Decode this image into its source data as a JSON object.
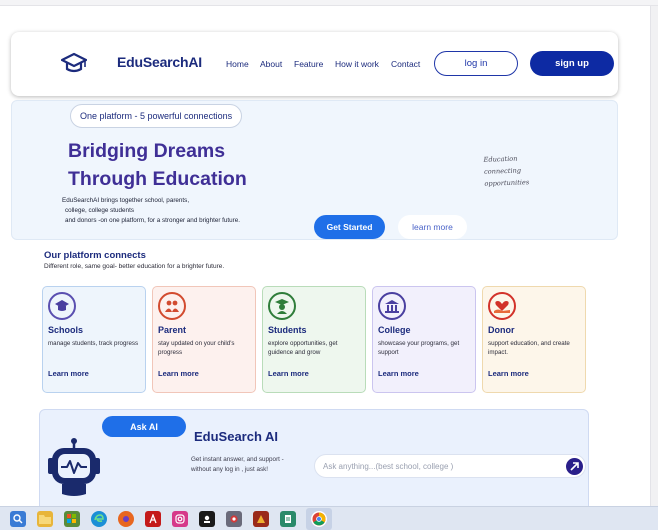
{
  "navbar": {
    "brand": "EduSearchAI",
    "links": [
      "Home",
      "About",
      "Feature",
      "How it work",
      "Contact"
    ],
    "login_label": "log in",
    "signup_label": "sign up"
  },
  "hero": {
    "pill": "One platform - 5 powerful connections",
    "title_line1": "Bridging Dreams",
    "title_line2": "Through Education",
    "desc_line1": "EduSearchAI brings together school, parents,",
    "desc_line2": "college, college students",
    "desc_line3": "and donors -on one platform, for a stronger and brighter future.",
    "handwritten": [
      "Education",
      "connecting",
      "opportunities"
    ],
    "get_started": "Get Started",
    "learn_more": "learn more"
  },
  "connect": {
    "title": "Our platform connects",
    "subtitle": "Different role, same goal- better education for a brighter future.",
    "cards": [
      {
        "name": "Schools",
        "desc": "manage students, track progress",
        "link": "Learn more",
        "icon": "school-icon",
        "bg": "#eef5fc",
        "border": "#b9d2ef",
        "iconColor": "#5a4fb0"
      },
      {
        "name": "Parent",
        "desc": "stay updated on your child's progress",
        "link": "Learn more",
        "icon": "parent-icon",
        "bg": "#fdf1ee",
        "border": "#f1c6b9",
        "iconColor": "#d24b2f"
      },
      {
        "name": "Students",
        "desc": "explore opportunities, get guidence and grow",
        "link": "Learn more",
        "icon": "student-icon",
        "bg": "#eef7ee",
        "border": "#b9dcb9",
        "iconColor": "#2f7d3a"
      },
      {
        "name": "College",
        "desc": "showcase your programs, get support",
        "link": "Learn more",
        "icon": "college-icon",
        "bg": "#f2f0fc",
        "border": "#cbc5ef",
        "iconColor": "#4a3fa0"
      },
      {
        "name": "Donor",
        "desc": "support education, and create impact.",
        "link": "Learn more",
        "icon": "donor-icon",
        "bg": "#fdf6ea",
        "border": "#efd9ae",
        "iconColor": "#d2322a"
      }
    ]
  },
  "ask": {
    "button": "Ask AI",
    "title": "EduSearch AI",
    "desc_line1": "Get instant answer, and support -",
    "desc_line2": "without any log in , just ask!",
    "placeholder": "Ask anything...(best school, college )"
  },
  "taskbar": {
    "icons": [
      "windows-search-icon",
      "file-explorer-icon",
      "store-icon",
      "edge-icon",
      "firefox-icon",
      "acrobat-icon",
      "instagram-icon",
      "media-icon",
      "camera-icon",
      "app-icon",
      "notepad-icon",
      "chrome-icon"
    ]
  }
}
